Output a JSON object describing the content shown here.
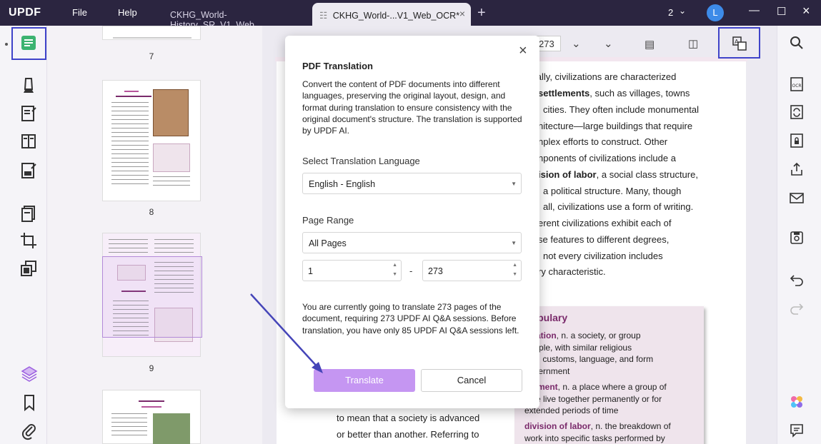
{
  "app": {
    "logo": "UPDF",
    "menu": [
      "File",
      "Help"
    ],
    "tabs": [
      {
        "label": "CKHG_World-History_SR_V1_Web"
      },
      {
        "label": "CKHG_World-...V1_Web_OCR*"
      }
    ],
    "window_count": "2",
    "avatar_letter": "L"
  },
  "thumbnails": {
    "pages": [
      "7",
      "8",
      "9"
    ]
  },
  "doc_toolbar": {
    "page_number": "273"
  },
  "document": {
    "lines": [
      "nerally, civilizations are characterized",
      "settlements",
      ", such as villages, towns",
      "cities. They often include monumental",
      "nitecture—large buildings that require",
      "nplex efforts to construct. Other",
      "nponents of civilizations include a",
      "ision of labor",
      ", a social class structure,",
      "a political structure. Many, though",
      "all, civilizations use a form of writing.",
      "erent civilizations exhibit each of",
      "se features to different degrees,",
      "not every civilization includes",
      "ry characteristic."
    ],
    "bottom_lines": [
      "to mean that a society is advanced",
      "or better than another. Referring to"
    ],
    "vocab": {
      "title": "ocabulary",
      "lines": [
        {
          "term": "ilization",
          "text": ", n. a society, or group"
        },
        {
          "term": "",
          "text": "people, with similar religious"
        },
        {
          "term": "",
          "text": "iefs, customs, language, and form"
        },
        {
          "term": "",
          "text": "government"
        },
        {
          "term": "ttlement",
          "text": ", n. a place where a group of"
        },
        {
          "term": "",
          "text": "ople live together permanently or for"
        },
        {
          "term": "",
          "text": "extended periods of time"
        },
        {
          "term": "division of labor",
          "text": ", n. the breakdown of"
        },
        {
          "term": "",
          "text": "work into specific tasks performed by"
        }
      ]
    }
  },
  "dialog": {
    "title": "PDF Translation",
    "description": "Convert the content of PDF documents into different languages, preserving the original layout, design, and format during translation to ensure consistency with the original document's structure. The translation is supported by UPDF AI.",
    "language_label": "Select Translation Language",
    "language_value": "English - English",
    "range_label": "Page Range",
    "range_value": "All Pages",
    "range_from": "1",
    "range_to": "273",
    "range_dash": "-",
    "note": "You are currently going to translate 273 pages of the document, requiring 273 UPDF AI Q&A sessions. Before translation, you have only 85 UPDF AI Q&A sessions left.",
    "translate_label": "Translate",
    "cancel_label": "Cancel"
  },
  "colors": {
    "titlebar": "#2b2540",
    "accent": "#c596f2",
    "highlight": "#3f43c9",
    "arrow": "#4545b8"
  }
}
